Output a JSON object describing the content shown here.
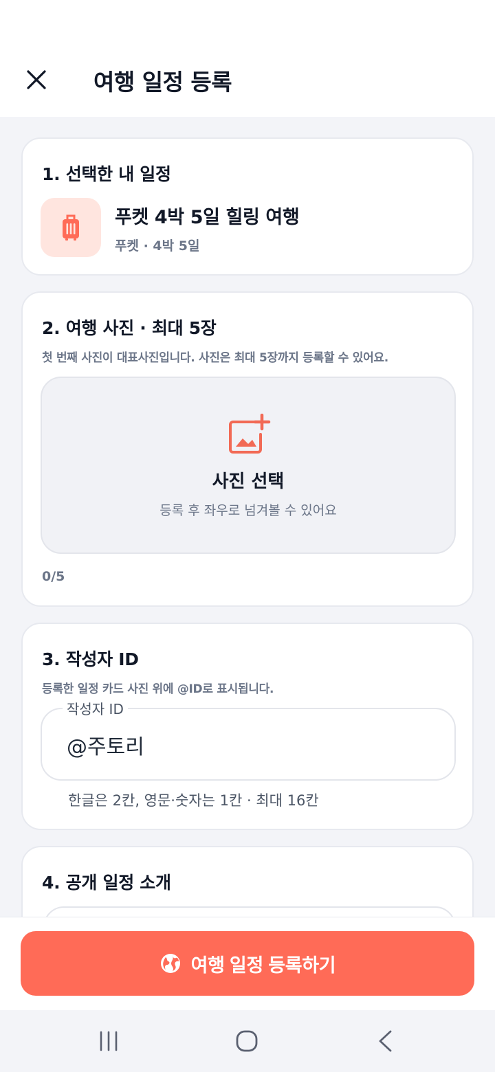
{
  "header": {
    "title": "여행 일정 등록",
    "close_icon": "close-icon"
  },
  "section1": {
    "title": "1. 선택한 내 일정",
    "trip_icon": "luggage-icon",
    "trip_name": "푸켓 4박 5일 힐링 여행",
    "trip_meta": "푸켓 · 4박 5일"
  },
  "section2": {
    "title": "2. 여행 사진 · 최대 5장",
    "description": "첫 번째 사진이 대표사진입니다. 사진은 최대 5장까지 등록할 수 있어요.",
    "picker_icon": "add-photo-icon",
    "picker_label": "사진 선택",
    "picker_hint": "등록 후 좌우로 넘겨볼 수 있어요",
    "count": "0/5"
  },
  "section3": {
    "title": "3. 작성자 ID",
    "description": "등록한 일정 카드 사진 위에 @ID로 표시됩니다.",
    "field_label": "작성자 ID",
    "field_value": "@주토리",
    "helper": "한글은 2칸, 영문·숫자는 1칸 · 최대 16칸"
  },
  "section4": {
    "title": "4. 공개 일정 소개"
  },
  "cta": {
    "icon": "globe-icon",
    "label": "여행 일정 등록하기"
  },
  "colors": {
    "accent": "#ff6b57",
    "accent_soft": "#ffe5df",
    "text_primary": "#111827",
    "text_secondary": "#6b7588",
    "background": "#f3f4f8"
  },
  "nav": {
    "recents_icon": "recents-icon",
    "home_icon": "home-icon",
    "back_icon": "back-icon"
  }
}
